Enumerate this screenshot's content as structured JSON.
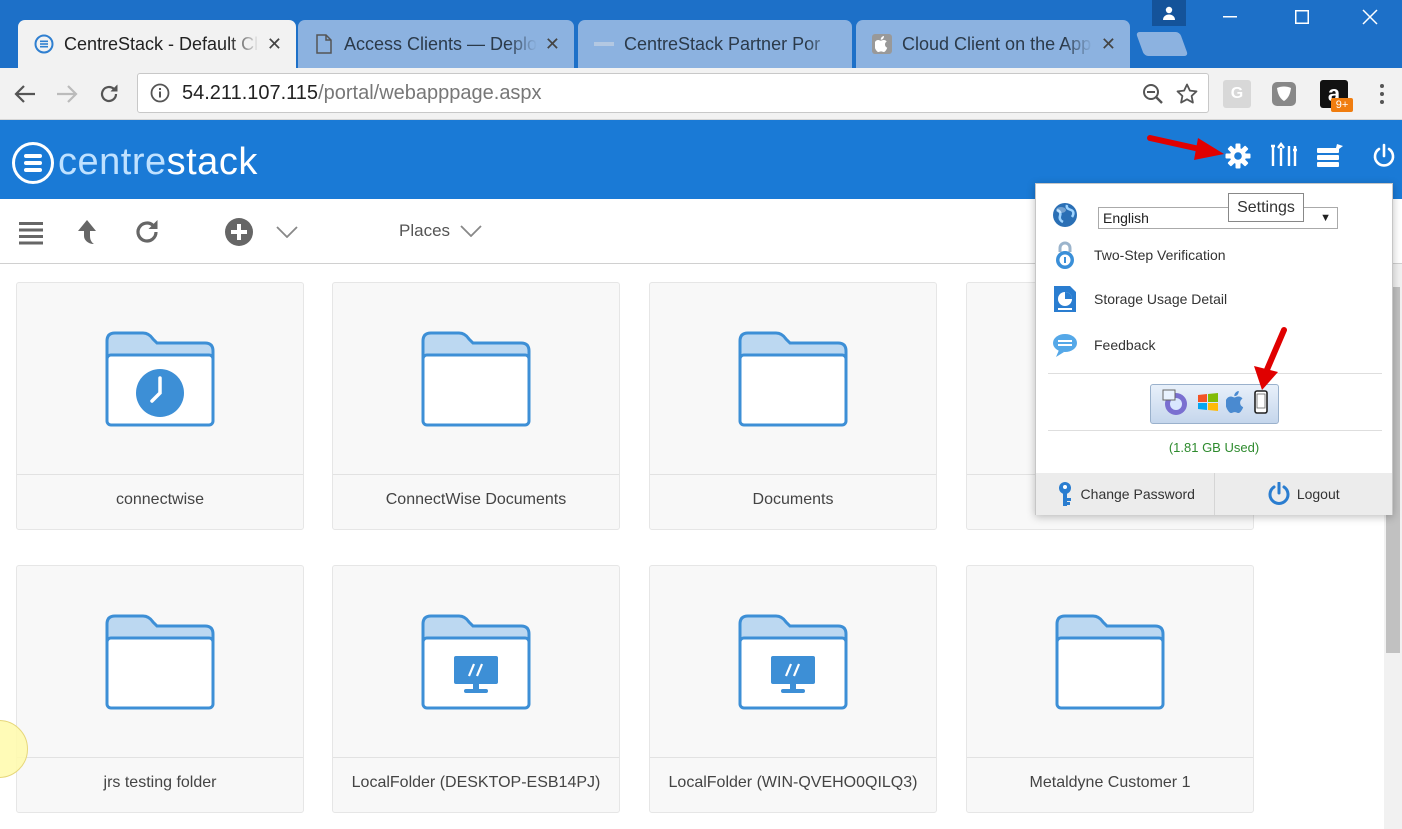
{
  "browser": {
    "tabs": [
      {
        "title": "CentreStack - Default Cl",
        "active": true
      },
      {
        "title": "Access Clients — Deplo",
        "active": false
      },
      {
        "title": "CentreStack Partner Por",
        "active": false
      },
      {
        "title": "Cloud Client on the App",
        "active": false
      }
    ],
    "tab_close": "✕",
    "address": {
      "host": "54.211.107.115",
      "path": "/portal/webapppage.aspx"
    },
    "extensions": {
      "g_label": "G",
      "amazon_label": "a",
      "amazon_badge": "9+"
    }
  },
  "app": {
    "logo": {
      "prefix": "centre",
      "suffix": "stack"
    },
    "toolbar": {
      "places_label": "Places"
    },
    "folders": [
      {
        "name": "connectwise",
        "icon": "clock-folder-icon"
      },
      {
        "name": "ConnectWise Documents",
        "icon": "folder-icon"
      },
      {
        "name": "Documents",
        "icon": "folder-icon"
      },
      {
        "name": "",
        "icon": "folder-icon"
      },
      {
        "name": "jrs testing folder",
        "icon": "folder-icon"
      },
      {
        "name": "LocalFolder (DESKTOP-ESB14PJ)",
        "icon": "monitor-folder-icon"
      },
      {
        "name": "LocalFolder (WIN-QVEHO0QILQ3)",
        "icon": "monitor-folder-icon"
      },
      {
        "name": "Metaldyne Customer 1",
        "icon": "folder-icon"
      }
    ]
  },
  "settings_menu": {
    "tooltip": "Settings",
    "language": "English",
    "items": {
      "two_step": "Two-Step Verification",
      "storage": "Storage Usage Detail",
      "feedback": "Feedback"
    },
    "usage": "(1.81 GB Used)",
    "change_password": "Change Password",
    "logout": "Logout"
  },
  "colors": {
    "header_blue": "#1a7ad6",
    "folder_blue": "#3d8fd6",
    "usage_green": "#2e8b2e",
    "arrow_red": "#e00000"
  }
}
